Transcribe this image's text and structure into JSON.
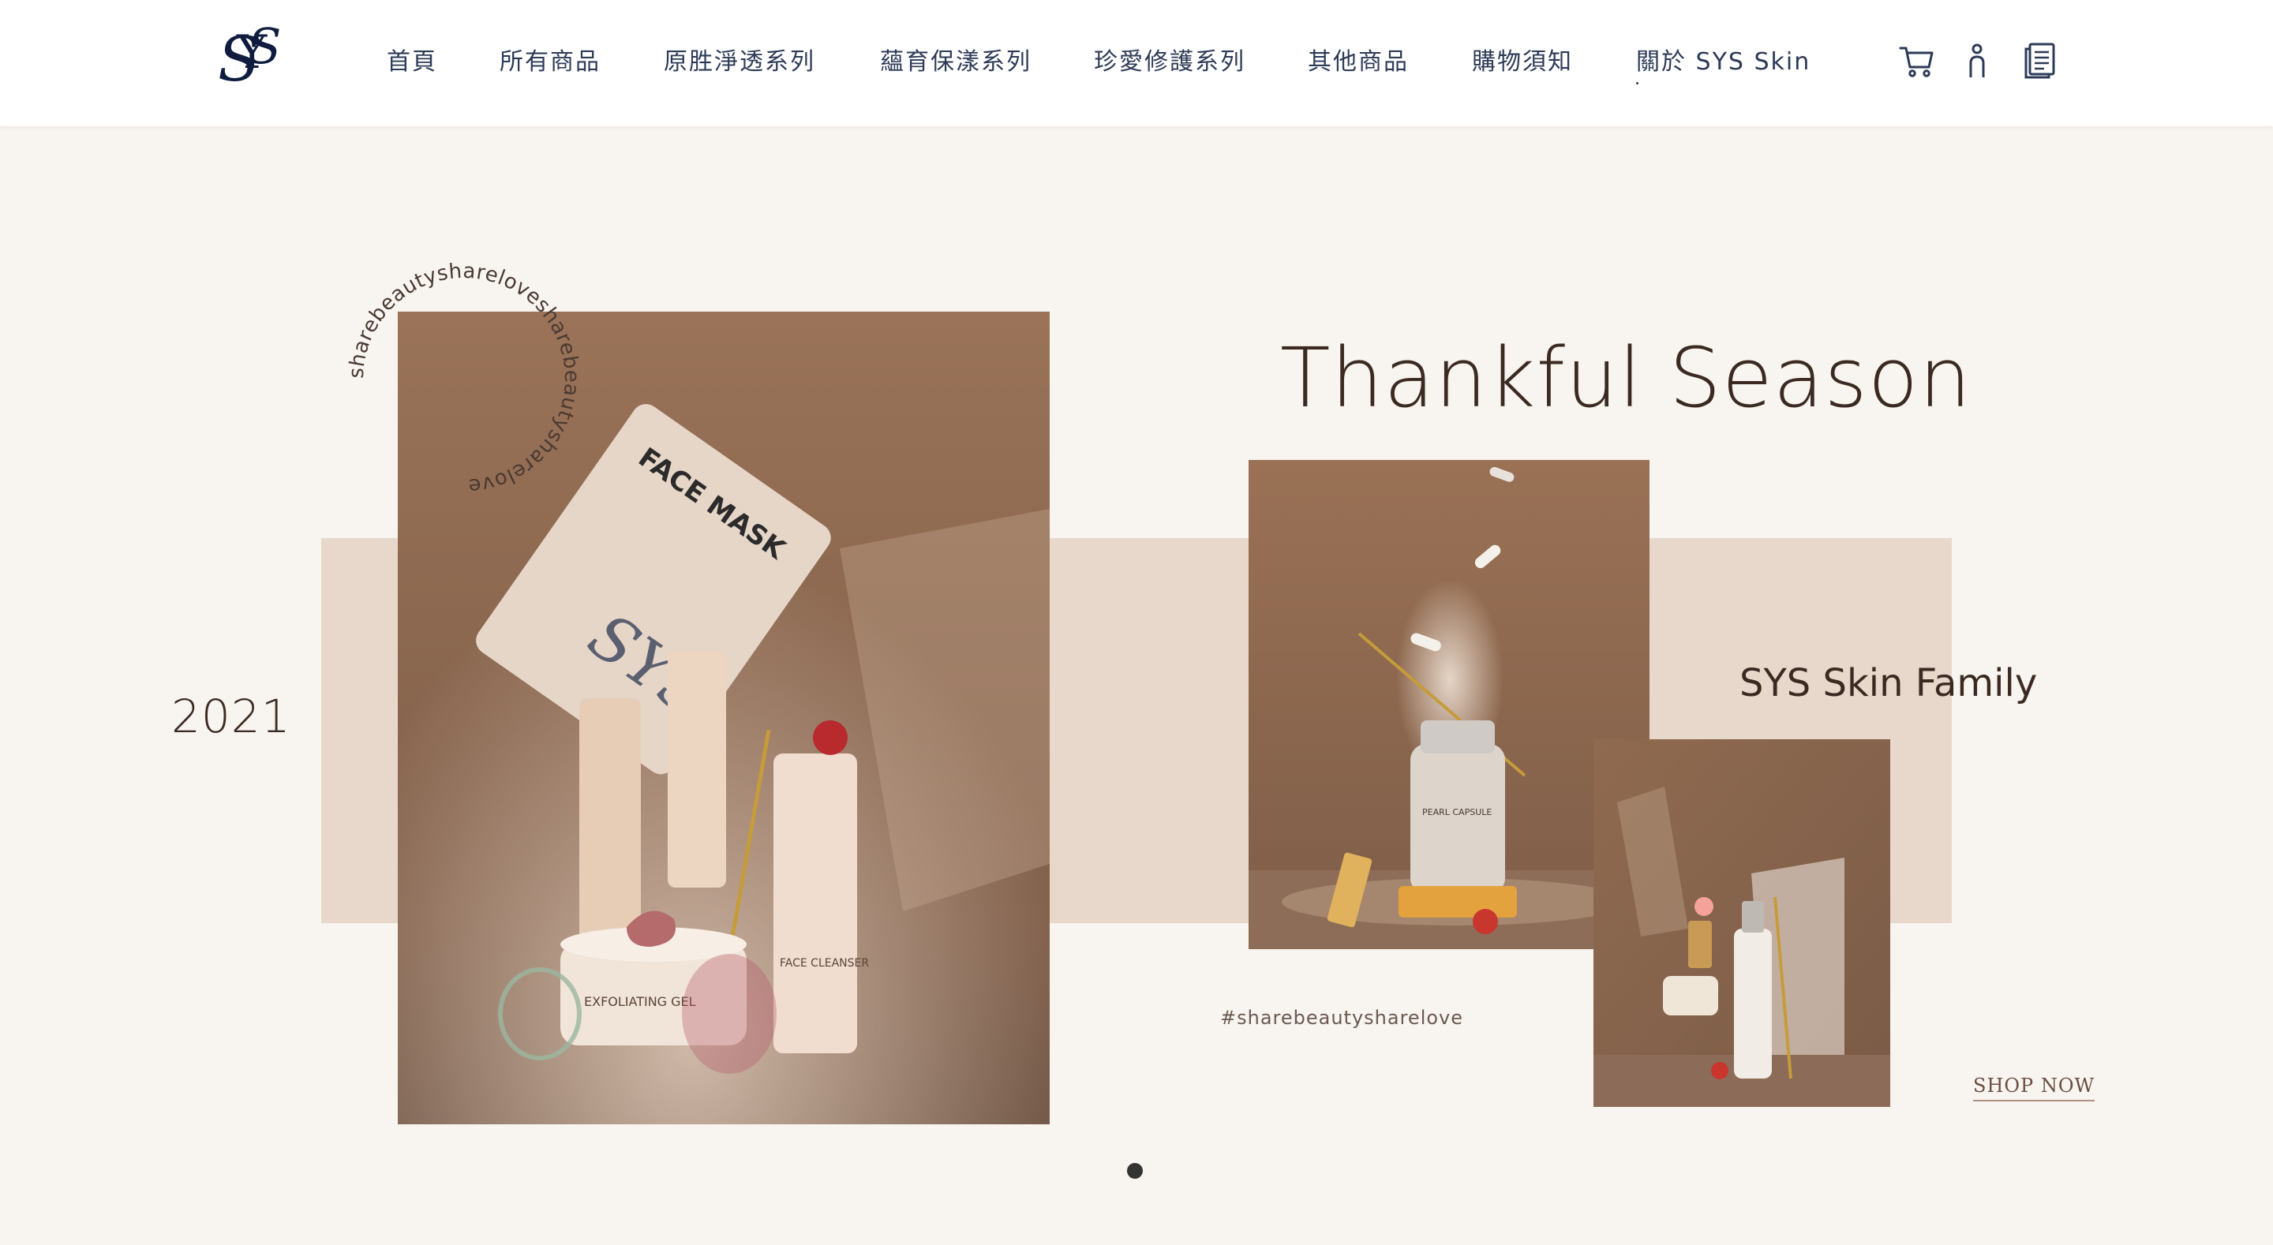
{
  "brand": {
    "logo_letters": "SYS",
    "accent": "#0f1c3f"
  },
  "nav": {
    "items": [
      {
        "label": "首頁"
      },
      {
        "label": "所有商品"
      },
      {
        "label": "原胜淨透系列"
      },
      {
        "label": "蘊育保漾系列"
      },
      {
        "label": "珍愛修護系列"
      },
      {
        "label": "其他商品"
      },
      {
        "label": "購物須知"
      },
      {
        "label": "關於 SYS Skin"
      }
    ],
    "icons": [
      "cart-icon",
      "user-icon",
      "orders-icon"
    ]
  },
  "hero": {
    "year": "2021",
    "headline": "Thankful Season",
    "subheadline": "SYS Skin Family",
    "hashtag": "#sharebeautysharelove",
    "circle_text": "sharebeautysharelovesharebeautysharelove",
    "cta": "SHOP NOW",
    "product_labels": {
      "mask": "FACE MASK",
      "exfoliating": "EXFOLIATING GEL",
      "cleanser": "FACE CLEANSER",
      "capsule": "PEARL CAPSULE"
    },
    "colors": {
      "background": "#f8f4f0",
      "band": "#e8d8cb",
      "photo_bg": "#8f6a52",
      "text": "#3b2a22"
    }
  },
  "carousel": {
    "active_index": 1,
    "count": 1
  }
}
